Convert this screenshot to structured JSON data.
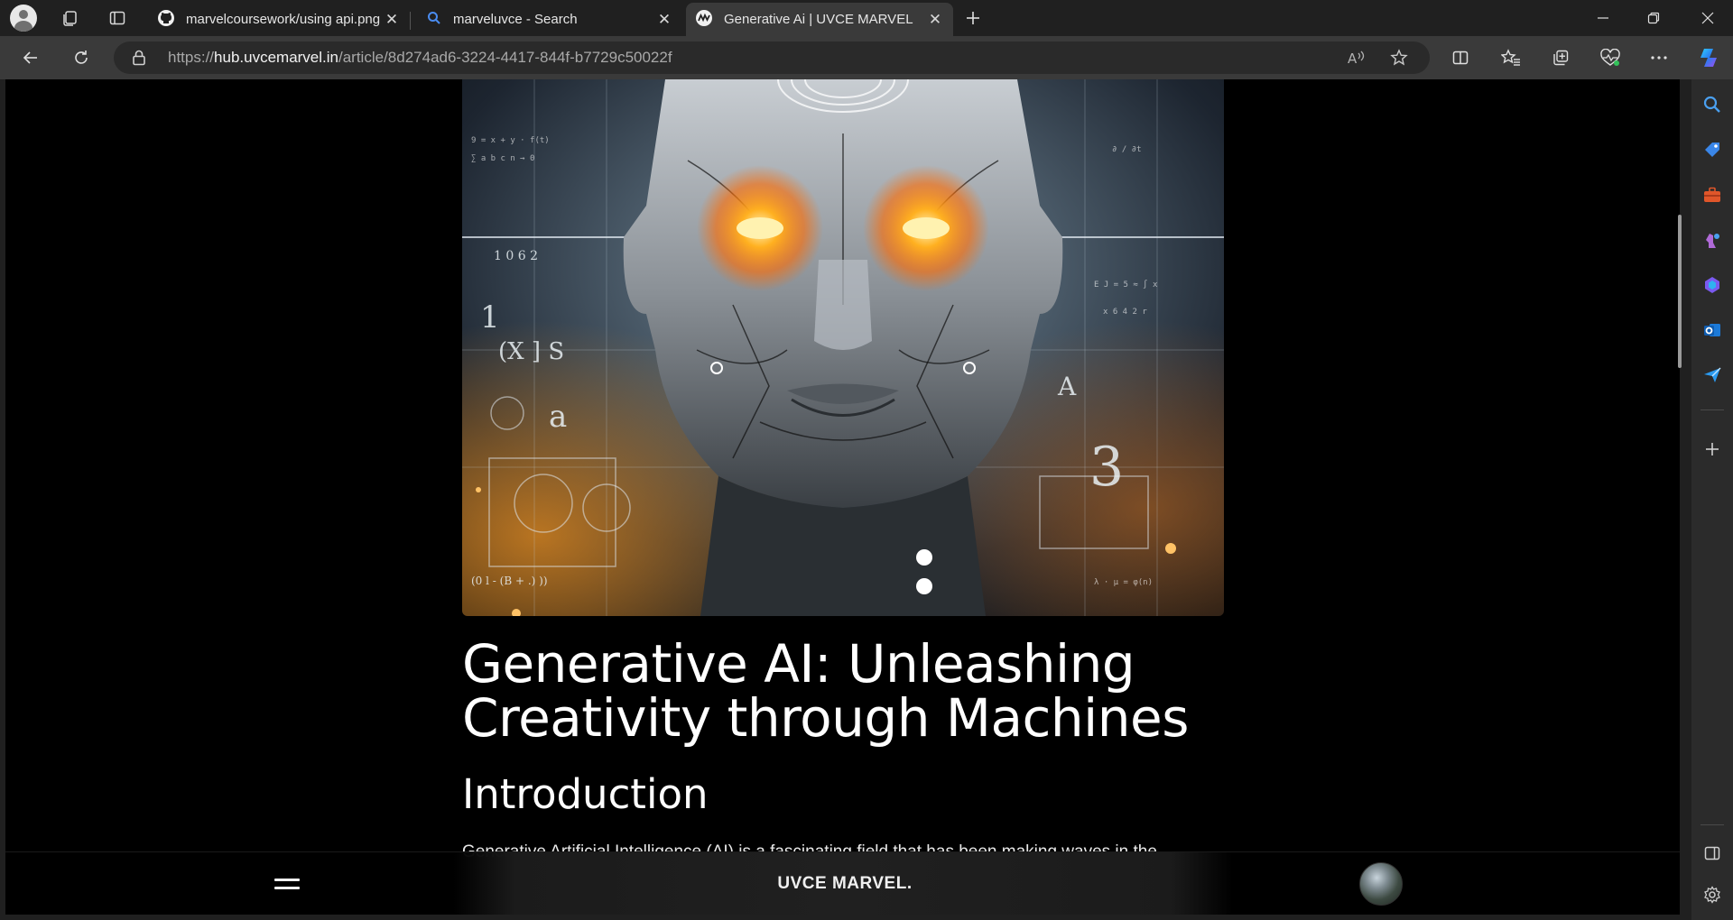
{
  "tabs": [
    {
      "title": "marvelcoursework/using api.png",
      "icon": "github-icon",
      "active": false
    },
    {
      "title": "marveluvce - Search",
      "icon": "search-icon",
      "active": false
    },
    {
      "title": "Generative Ai | UVCE MARVEL",
      "icon": "marvel-icon",
      "active": true
    }
  ],
  "address_bar": {
    "prefix": "https://",
    "host": "hub.uvcemarvel.in",
    "path": "/article/8d274ad6-3224-4417-844f-b7729c50022f"
  },
  "article": {
    "title_line1": "Generative AI: Unleashing",
    "title_line2": "Creativity through Machines",
    "section_heading": "Introduction",
    "paragraph_start": "Generative Artificial Intelligence (AI) is a fascinating field that has been making waves in the"
  },
  "bottom_nav": {
    "brand": "UVCE MARVEL."
  },
  "colors": {
    "page_bg": "#000000",
    "chrome_bg": "#202020",
    "toolbar_bg": "#3a3a3a",
    "accent_orange": "#ff9a1f"
  }
}
